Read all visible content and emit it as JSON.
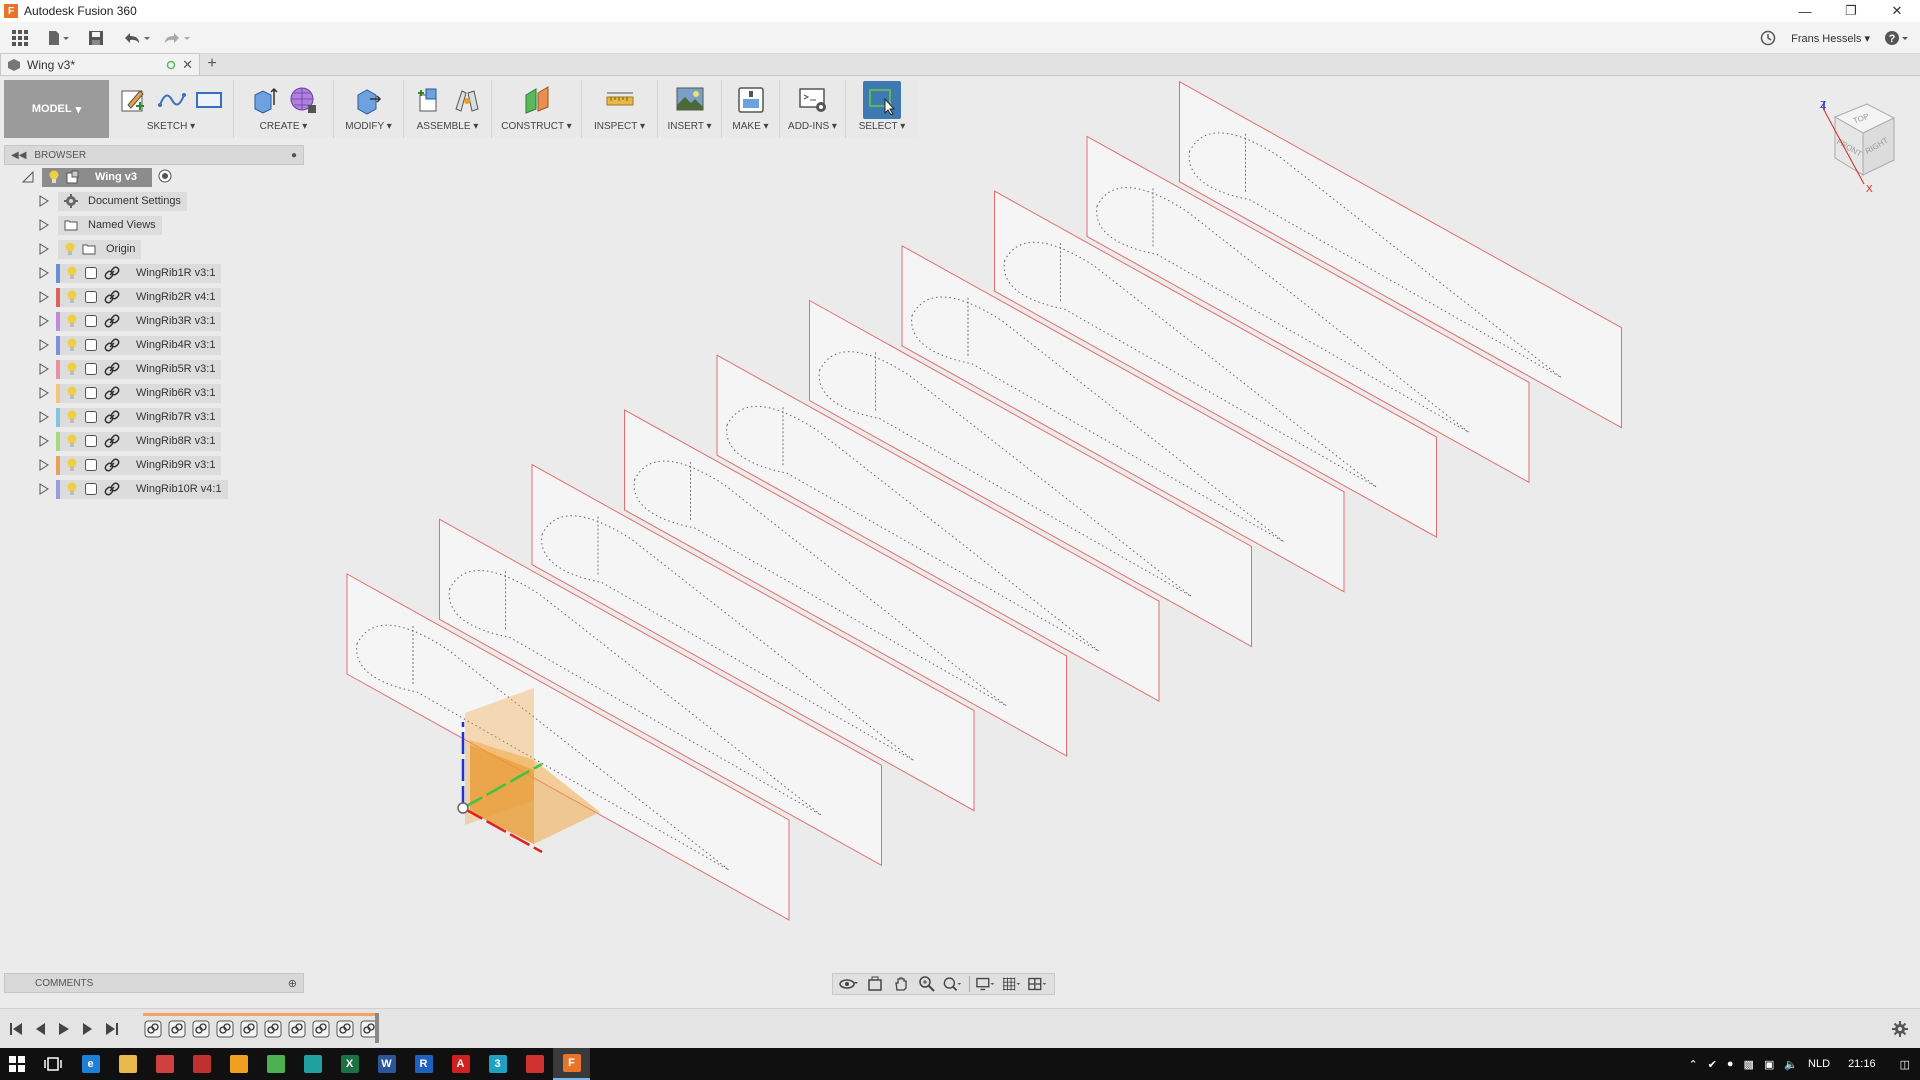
{
  "window": {
    "title": "Autodesk Fusion 360",
    "app_icon": "F",
    "minimize_icon": "minimize-icon",
    "restore_icon": "restore-icon",
    "close_icon": "close-icon"
  },
  "quick_access": {
    "user": "Frans Hessels"
  },
  "tab": {
    "name": "Wing v3*"
  },
  "ribbon": {
    "workspace": "MODEL",
    "groups": [
      "SKETCH",
      "CREATE",
      "MODIFY",
      "ASSEMBLE",
      "CONSTRUCT",
      "INSPECT",
      "INSERT",
      "MAKE",
      "ADD-INS",
      "SELECT"
    ]
  },
  "browser": {
    "title": "BROWSER",
    "root": "Wing v3",
    "folders": [
      "Document Settings",
      "Named Views",
      "Origin"
    ],
    "components": [
      {
        "label": "WingRib1R v3:1",
        "color": "#6a8fd6"
      },
      {
        "label": "WingRib2R v4:1",
        "color": "#e06060"
      },
      {
        "label": "WingRib3R v3:1",
        "color": "#c08ad8"
      },
      {
        "label": "WingRib4R v3:1",
        "color": "#7f8fe0"
      },
      {
        "label": "WingRib5R v3:1",
        "color": "#e88fa0"
      },
      {
        "label": "WingRib6R v3:1",
        "color": "#f0c878"
      },
      {
        "label": "WingRib7R v3:1",
        "color": "#7fc8e0"
      },
      {
        "label": "WingRib8R v3:1",
        "color": "#a8d878"
      },
      {
        "label": "WingRib9R v3:1",
        "color": "#e8a060"
      },
      {
        "label": "WingRib10R v4:1",
        "color": "#9a9ae0"
      }
    ]
  },
  "viewcube": {
    "top": "TOP",
    "front": "FRONT",
    "right": "RIGHT",
    "axis_z": "Z",
    "axis_x": "X"
  },
  "comments": {
    "title": "COMMENTS"
  },
  "taskbar": {
    "language": "NLD",
    "time": "21:16",
    "apps": [
      {
        "icon": "edge-icon",
        "letter": "e",
        "color": "#1e7fd6"
      },
      {
        "icon": "explorer-icon",
        "letter": "",
        "color": "#e8b84a"
      },
      {
        "icon": "app-icon-1",
        "letter": "",
        "color": "#d04040"
      },
      {
        "icon": "app-icon-2",
        "letter": "",
        "color": "#c03030"
      },
      {
        "icon": "app-icon-3",
        "letter": "",
        "color": "#f0a020"
      },
      {
        "icon": "chrome-icon",
        "letter": "",
        "color": "#4caf50"
      },
      {
        "icon": "app-icon-4",
        "letter": "",
        "color": "#20a0a0"
      },
      {
        "icon": "excel-icon",
        "letter": "X",
        "color": "#1e7145"
      },
      {
        "icon": "word-icon",
        "letter": "W",
        "color": "#2b579a"
      },
      {
        "icon": "app-icon-5",
        "letter": "R",
        "color": "#2060c0"
      },
      {
        "icon": "acrobat-icon",
        "letter": "A",
        "color": "#d02020"
      },
      {
        "icon": "app-icon-6",
        "letter": "3",
        "color": "#20a0c0"
      },
      {
        "icon": "app-icon-7",
        "letter": "",
        "color": "#d03030"
      },
      {
        "icon": "fusion-icon",
        "letter": "F",
        "color": "#e8742a"
      }
    ]
  }
}
